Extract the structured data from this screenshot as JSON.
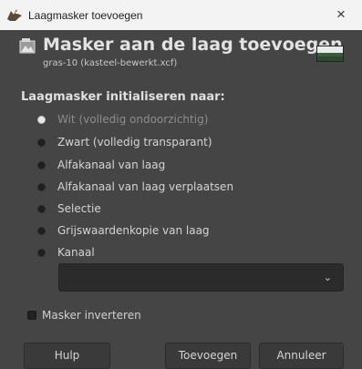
{
  "window": {
    "title": "Laagmasker toevoegen",
    "close_glyph": "×",
    "app_icon": "gimp-wilber-icon"
  },
  "header": {
    "title": "Masker aan de laag toevoegen",
    "subtitle": "gras-10 (kasteel-bewerkt.xcf)",
    "icon": "layer-mask-icon",
    "thumbnail": "layer-thumbnail"
  },
  "init_section": {
    "label": "Laagmasker initialiseren naar:",
    "options": [
      {
        "label": "Wit (volledig ondoorzichtig)",
        "selected": true
      },
      {
        "label": "Zwart (volledig transparant)",
        "selected": false
      },
      {
        "label": "Alfakanaal van laag",
        "selected": false
      },
      {
        "label": "Alfakanaal van laag verplaatsen",
        "selected": false
      },
      {
        "label": "Selectie",
        "selected": false
      },
      {
        "label": "Grijswaardenkopie van laag",
        "selected": false
      },
      {
        "label": "Kanaal",
        "selected": false
      }
    ]
  },
  "channel_select": {
    "value": "",
    "icon": "chevron-down-icon"
  },
  "invert_mask": {
    "label": "Masker inverteren",
    "checked": false
  },
  "buttons": {
    "help": "Hulp",
    "add": "Toevoegen",
    "cancel": "Annuleer"
  },
  "colors": {
    "background": "#454545",
    "titlebar": "#f3f3f3",
    "button": "#3a3a3a",
    "select": "#2b2b2b"
  }
}
